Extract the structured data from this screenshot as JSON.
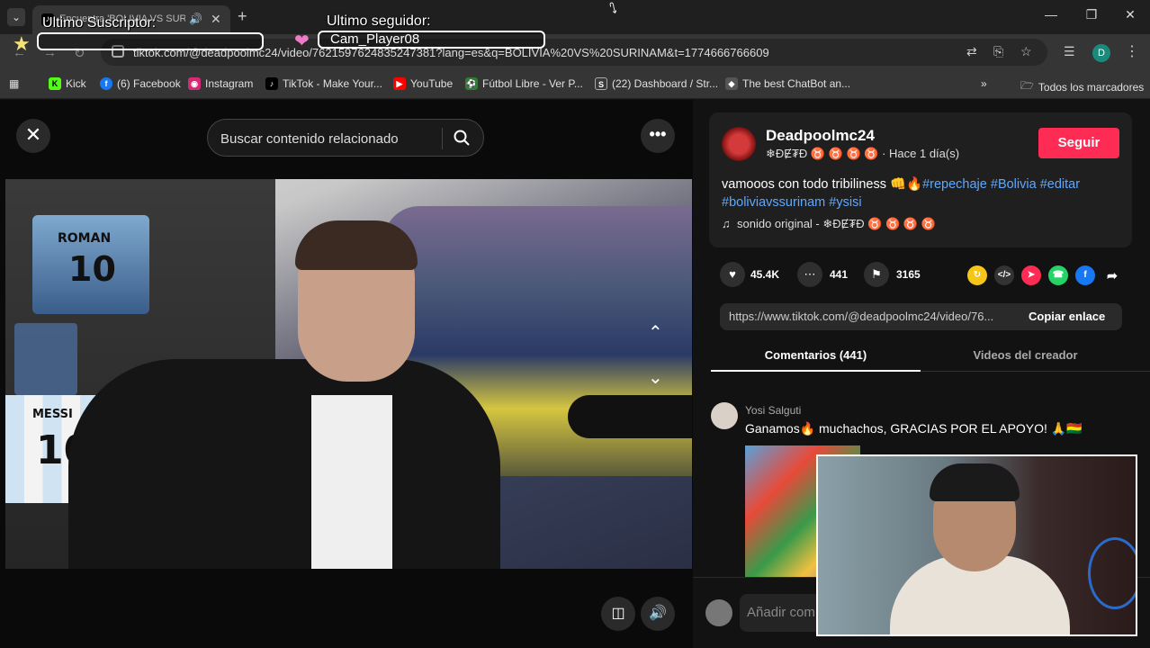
{
  "browser": {
    "tab_title": "Encuentra 'BOLIVIA VS SURINAM'",
    "url": "tiktok.com/@deadpoolmc24/video/7621597624835247381?lang=es&q=BOLIVIA%20VS%20SURINAM&t=1774666766609",
    "profile_letter": "D",
    "bookmarks": [
      {
        "label": "Kick",
        "color": "#53fc18"
      },
      {
        "label": "(6) Facebook",
        "color": "#1877f2"
      },
      {
        "label": "Instagram",
        "color": "#d62976"
      },
      {
        "label": "TikTok - Make Your...",
        "color": "#000000"
      },
      {
        "label": "YouTube",
        "color": "#ff0000"
      },
      {
        "label": "Fútbol Libre - Ver P...",
        "color": "#2e7d32"
      },
      {
        "label": "(22) Dashboard / Str...",
        "color": "#3a3a3a"
      },
      {
        "label": "The best ChatBot an...",
        "color": "#555555"
      }
    ],
    "all_bookmarks": "Todos los marcadores"
  },
  "overlay": {
    "subscriber_label": "Ultimo Suscriptor:",
    "subscriber_value": "",
    "follower_label": "Ultimo seguidor:",
    "follower_value": "Cam_Player08"
  },
  "video": {
    "search_placeholder": "Buscar contenido relacionado",
    "jersey_roman_name": "ROMAN",
    "jersey_roman_number": "10",
    "jersey_messi_name": "MESSI",
    "jersey_messi_number": "10"
  },
  "post": {
    "author": "Deadpoolmc24",
    "author_sub": "❄ĐɆ₮Đ ♉ ♉ ♉ ♉ · Hace 1 día(s)",
    "follow_label": "Seguir",
    "desc_text": "vamooos con todo tribiliness 👊🔥",
    "hashtags": [
      "#repechaje",
      "#Bolivia",
      "#editar",
      "#boliviavssurinam",
      "#ysisi"
    ],
    "music": "sonido original - ❄ĐɆ₮Đ ♉ ♉ ♉ ♉",
    "likes": "45.4K",
    "comments": "441",
    "saves": "3165",
    "link": "https://www.tiktok.com/@deadpoolmc24/video/76...",
    "copy_label": "Copiar enlace"
  },
  "tabs": {
    "comments": "Comentarios (441)",
    "creator_videos": "Videos del creador"
  },
  "comment": {
    "author": "Yosi Salguti",
    "text": "Ganamos🔥 muchachos, GRACIAS POR EL APOYO! 🙏🇧🇴"
  },
  "add_comment_placeholder": "Añadir com"
}
